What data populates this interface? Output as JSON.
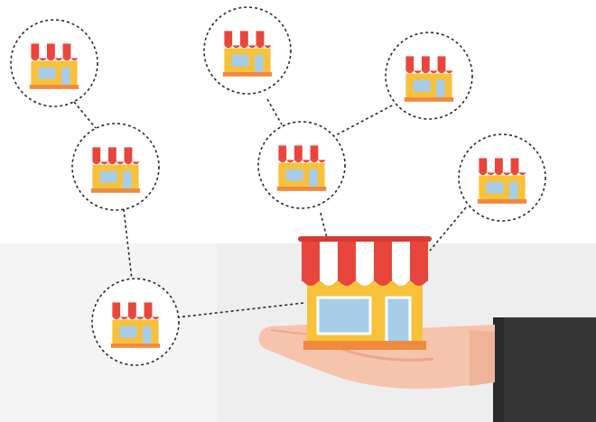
{
  "diagram": {
    "colors": {
      "awning_red": "#e8453c",
      "awning_white": "#ffffff",
      "wall_yellow": "#f7c23a",
      "window_blue": "#a7cde8",
      "base_orange": "#f08a3e",
      "connector": "#2a2a2a",
      "skin": "#f6c4ad",
      "sleeve": "#353535",
      "floor_gray": "#f1f1f1"
    },
    "icons": {
      "node": "storefront-icon",
      "central": "storefront-icon",
      "hand": "open-palm-hand-icon",
      "sleeve": "suit-sleeve-icon"
    },
    "nodes": [
      "store-1",
      "store-2",
      "store-3",
      "store-4",
      "store-5",
      "store-6",
      "store-7"
    ],
    "edges": [
      [
        "store-1",
        "store-2"
      ],
      [
        "store-2",
        "store-3"
      ],
      [
        "store-3",
        "central-store"
      ],
      [
        "store-4",
        "store-5"
      ],
      [
        "store-5",
        "store-6"
      ],
      [
        "store-5",
        "central-store"
      ],
      [
        "store-7",
        "central-store"
      ]
    ]
  }
}
